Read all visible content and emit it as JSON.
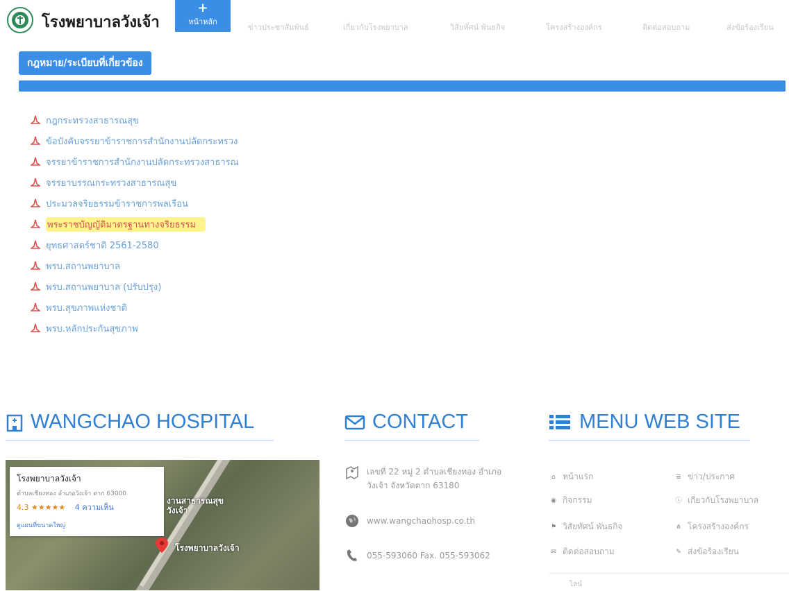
{
  "header": {
    "site_title": "โรงพยาบาลวังเจ้า",
    "logo_icon": "hospital-logo-icon",
    "nav": {
      "home": "หน้าหลัก",
      "items": [
        "ข่าวประชาสัมพันธ์",
        "เกี่ยวกับโรงพยาบาล",
        "วิสัยทัศน์ พันธกิจ",
        "โครงสร้างองค์กร",
        "ติดต่อสอบถาม",
        "ส่งข้อร้องเรียน"
      ]
    }
  },
  "section": {
    "button_label": "กฎหมาย/ระเบียบที่เกี่ยวข้อง",
    "accent_color": "#3a8ee6"
  },
  "laws": [
    "กฎกระทรวงสาธารณสุข",
    "ข้อบังคับจรรยาข้าราชการสำนักงานปลัดกระทรวง",
    "จรรยาข้าราชการสำนักงานปลัดกระทรวงสาธารณ",
    "จรรยาบรรณกระทรวงสาธารณสุข",
    "ประมวลจริยธรรมข้าราชการพลเรือน",
    "พระราชบัญญัติมาตรฐานทางจริยธรรม",
    "ยุทธศาสตร์ชาติ 2561-2580",
    "พรบ.สถานพยาบาล",
    "พรบ.สถานพยาบาล (ปรับปรุง)",
    "พรบ.สุขภาพแห่งชาติ",
    "พรบ.หลักประกันสุขภาพ"
  ],
  "highlighted_index": 5,
  "footer": {
    "hospital_heading": "WANGCHAO HOSPITAL",
    "contact_heading": "CONTACT",
    "menu_heading": "MENU WEB SITE",
    "map": {
      "place_name": "โรงพยาบาลวังเจ้า",
      "address": "ตำบลเชียงทอง อำเภอวังเจ้า ตาก 63000",
      "rating": "4.3 ★★★★★",
      "reviews": "4 ความเห็น",
      "larger_map": "ดูแผนที่ขนาดใหญ่",
      "label_health": "งานสาธารณสุข\nวังเจ้า",
      "label_hospital": "โรงพยาบาลวังเจ้า"
    },
    "contact": {
      "address_line1": "เลขที่ 22 หมู่ 2 ตำบลเชียงทอง อำเภอ",
      "address_line2": "วังเจ้า จังหวัดตาก 63180",
      "website": "www.wangchaohosp.co.th",
      "phone": "055-593060 Fax. 055-593062"
    },
    "menu": {
      "left": [
        "หน้าแรก",
        "กิจกรรม",
        "วิสัยทัศน์ พันธกิจ",
        "ติดต่อสอบถาม"
      ],
      "right": [
        "ข่าว/ประกาศ",
        "เกี่ยวกับโรงพยาบาล",
        "โครงสร้างองค์กร",
        "ส่งข้อร้องเรียน"
      ],
      "bottom_label": "ไลน์"
    }
  }
}
